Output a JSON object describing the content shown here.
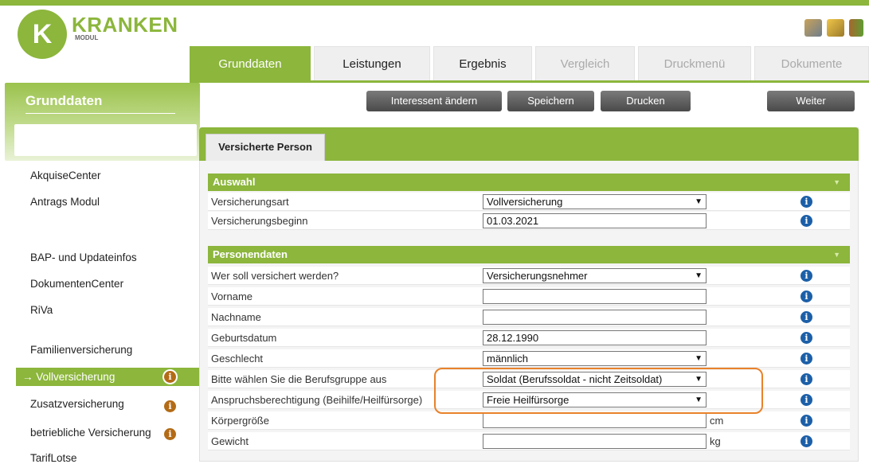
{
  "logo": {
    "mark": "K",
    "brand": "KRANKEN",
    "sub": "MODUL"
  },
  "tabs": [
    {
      "label": "Grunddaten",
      "state": "active"
    },
    {
      "label": "Leistungen",
      "state": "normal"
    },
    {
      "label": "Ergebnis",
      "state": "normal"
    },
    {
      "label": "Vergleich",
      "state": "disabled"
    },
    {
      "label": "Druckmenü",
      "state": "disabled"
    },
    {
      "label": "Dokumente",
      "state": "disabled"
    }
  ],
  "sidebar": {
    "title": "Grunddaten",
    "items": [
      {
        "label": "AkquiseCenter"
      },
      {
        "label": "Antrags Modul"
      },
      {
        "label": "BAP- und Updateinfos"
      },
      {
        "label": "DokumentenCenter"
      },
      {
        "label": "RiVa"
      },
      {
        "label": "Familienversicherung"
      },
      {
        "label": "Vollversicherung",
        "active": true
      },
      {
        "label": "Zusatzversicherung"
      },
      {
        "label": "betriebliche Versicherung"
      },
      {
        "label": "TarifLotse"
      }
    ],
    "active_arrow": "→"
  },
  "buttons": {
    "interessent": "Interessent ändern",
    "speichern": "Speichern",
    "drucken": "Drucken",
    "weiter": "Weiter"
  },
  "panel_tab": "Versicherte Person",
  "info_glyph": "i",
  "auswahl": {
    "title": "Auswahl",
    "rows": [
      {
        "label": "Versicherungsart",
        "value": "Vollversicherung",
        "type": "select"
      },
      {
        "label": "Versicherungsbeginn",
        "value": "01.03.2021",
        "type": "text"
      }
    ]
  },
  "personendaten": {
    "title": "Personendaten",
    "rows": [
      {
        "label": "Wer soll versichert werden?",
        "value": "Versicherungsnehmer",
        "type": "select"
      },
      {
        "label": "Vorname",
        "value": "",
        "type": "text"
      },
      {
        "label": "Nachname",
        "value": "",
        "type": "text"
      },
      {
        "label": "Geburtsdatum",
        "value": "28.12.1990",
        "type": "text"
      },
      {
        "label": "Geschlecht",
        "value": "männlich",
        "type": "select"
      },
      {
        "label": "Bitte wählen Sie die Berufsgruppe aus",
        "value": "Soldat (Berufssoldat - nicht Zeitsoldat)",
        "type": "select"
      },
      {
        "label": "Anspruchsberechtigung (Beihilfe/Heilfürsorge)",
        "value": "Freie Heilfürsorge",
        "type": "select"
      },
      {
        "label": "Körpergröße",
        "value": "",
        "type": "text",
        "unit": "cm"
      },
      {
        "label": "Gewicht",
        "value": "",
        "type": "text",
        "unit": "kg"
      }
    ]
  },
  "colors": {
    "accent": "#8cb63c",
    "info": "#1c5fa8",
    "warn": "#b36b16",
    "highlight": "#e8822a"
  },
  "icons": {
    "tools": "tools-icon",
    "edit": "edit-folder-icon",
    "exit": "exit-door-icon",
    "caret": "▼",
    "dropdown": "▼"
  }
}
